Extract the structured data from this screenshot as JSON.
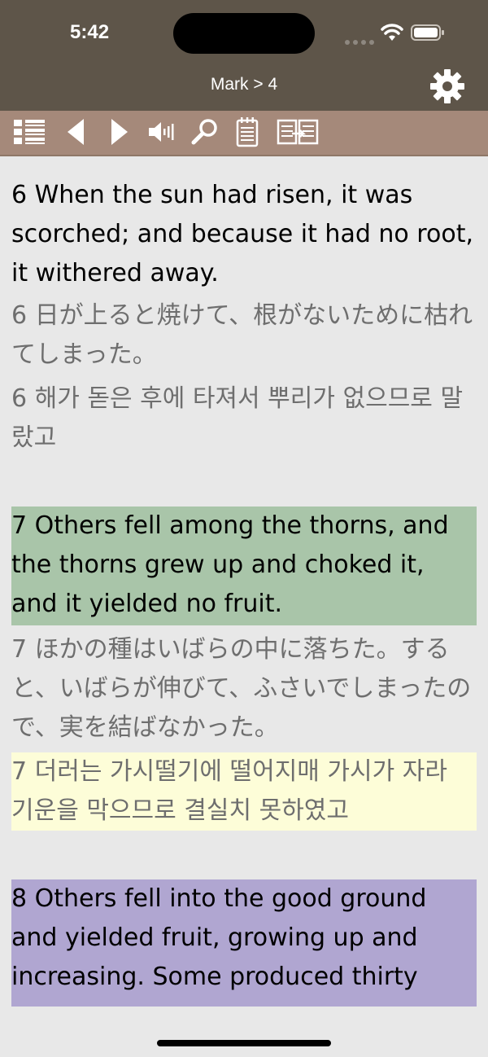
{
  "status_bar": {
    "time": "5:42"
  },
  "nav": {
    "title": "Mark > 4"
  },
  "toolbar": {
    "icons": [
      "list-icon",
      "back-arrow-icon",
      "forward-arrow-icon",
      "speaker-icon",
      "search-icon",
      "notepad-icon",
      "compare-icon",
      "settings-icon"
    ]
  },
  "verses": [
    {
      "en": "6  When the sun had risen, it was scorched; and because it had no root, it withered away.",
      "jp": "6  日が上ると焼けて、根がないために枯れてしまった。",
      "ko": "6  해가 돋은 후에 타져서 뿌리가 없으므로 말랐고"
    },
    {
      "en": "7  Others fell among the thorns, and the thorns grew up and choked it, and it yielded no fruit.",
      "jp": "7  ほかの種はいばらの中に落ちた。すると、いばらが伸びて、ふさいでしまったので、実を結ばなかった。",
      "ko": "7  더러는 가시떨기에 떨어지매 가시가 자라 기운을 막으므로 결실치 못하였고"
    },
    {
      "en": "8  Others fell into the good ground and yielded fruit, growing up and increasing. Some produced thirty"
    }
  ],
  "highlight_colors": {
    "green": "#a9c5a9",
    "yellow": "#fdfdd8",
    "purple": "#b0a6d1"
  }
}
